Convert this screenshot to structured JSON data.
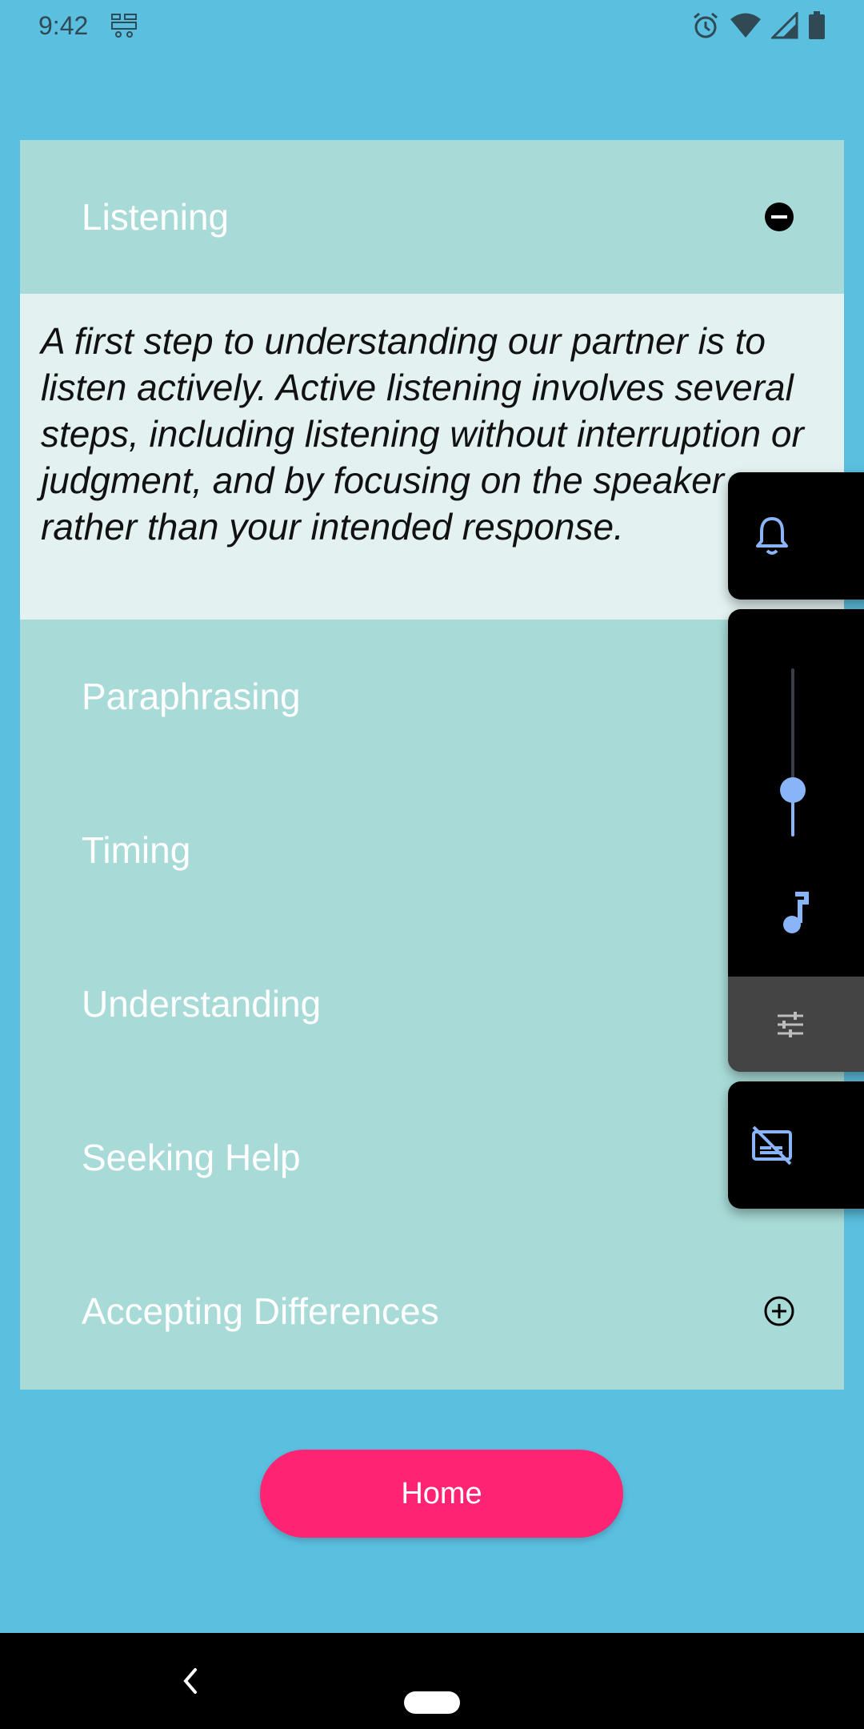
{
  "status_bar": {
    "time": "9:42",
    "icons": [
      "notification-icon",
      "alarm-icon",
      "wifi-icon",
      "signal-icon",
      "battery-icon"
    ]
  },
  "accordion": {
    "open_section": {
      "title": "Listening",
      "toggle_icon": "minus-circle-icon",
      "body": "A first step to understanding our partner is to listen actively. Active listening involves several steps, including listening without interruption or judgment, and by focusing on the speaker rather than your intended response."
    },
    "sections": [
      {
        "title": "Paraphrasing"
      },
      {
        "title": "Timing"
      },
      {
        "title": "Understanding"
      },
      {
        "title": "Seeking Help"
      },
      {
        "title": "Accepting Differences",
        "toggle_icon": "plus-circle-icon"
      }
    ]
  },
  "home_button": {
    "label": "Home"
  },
  "volume_panel": {
    "ringer_icon": "bell-icon",
    "media_icon": "music-note-icon",
    "settings_icon": "equalizer-icon",
    "caption_icon": "captions-off-icon",
    "media_volume_level": 0.3,
    "accent": "#8ab4f8"
  },
  "colors": {
    "background": "#5bbfdf",
    "accordion": "#a8dbd7",
    "accordion_body": "#e3f1f1",
    "home_button": "#ff2473"
  }
}
